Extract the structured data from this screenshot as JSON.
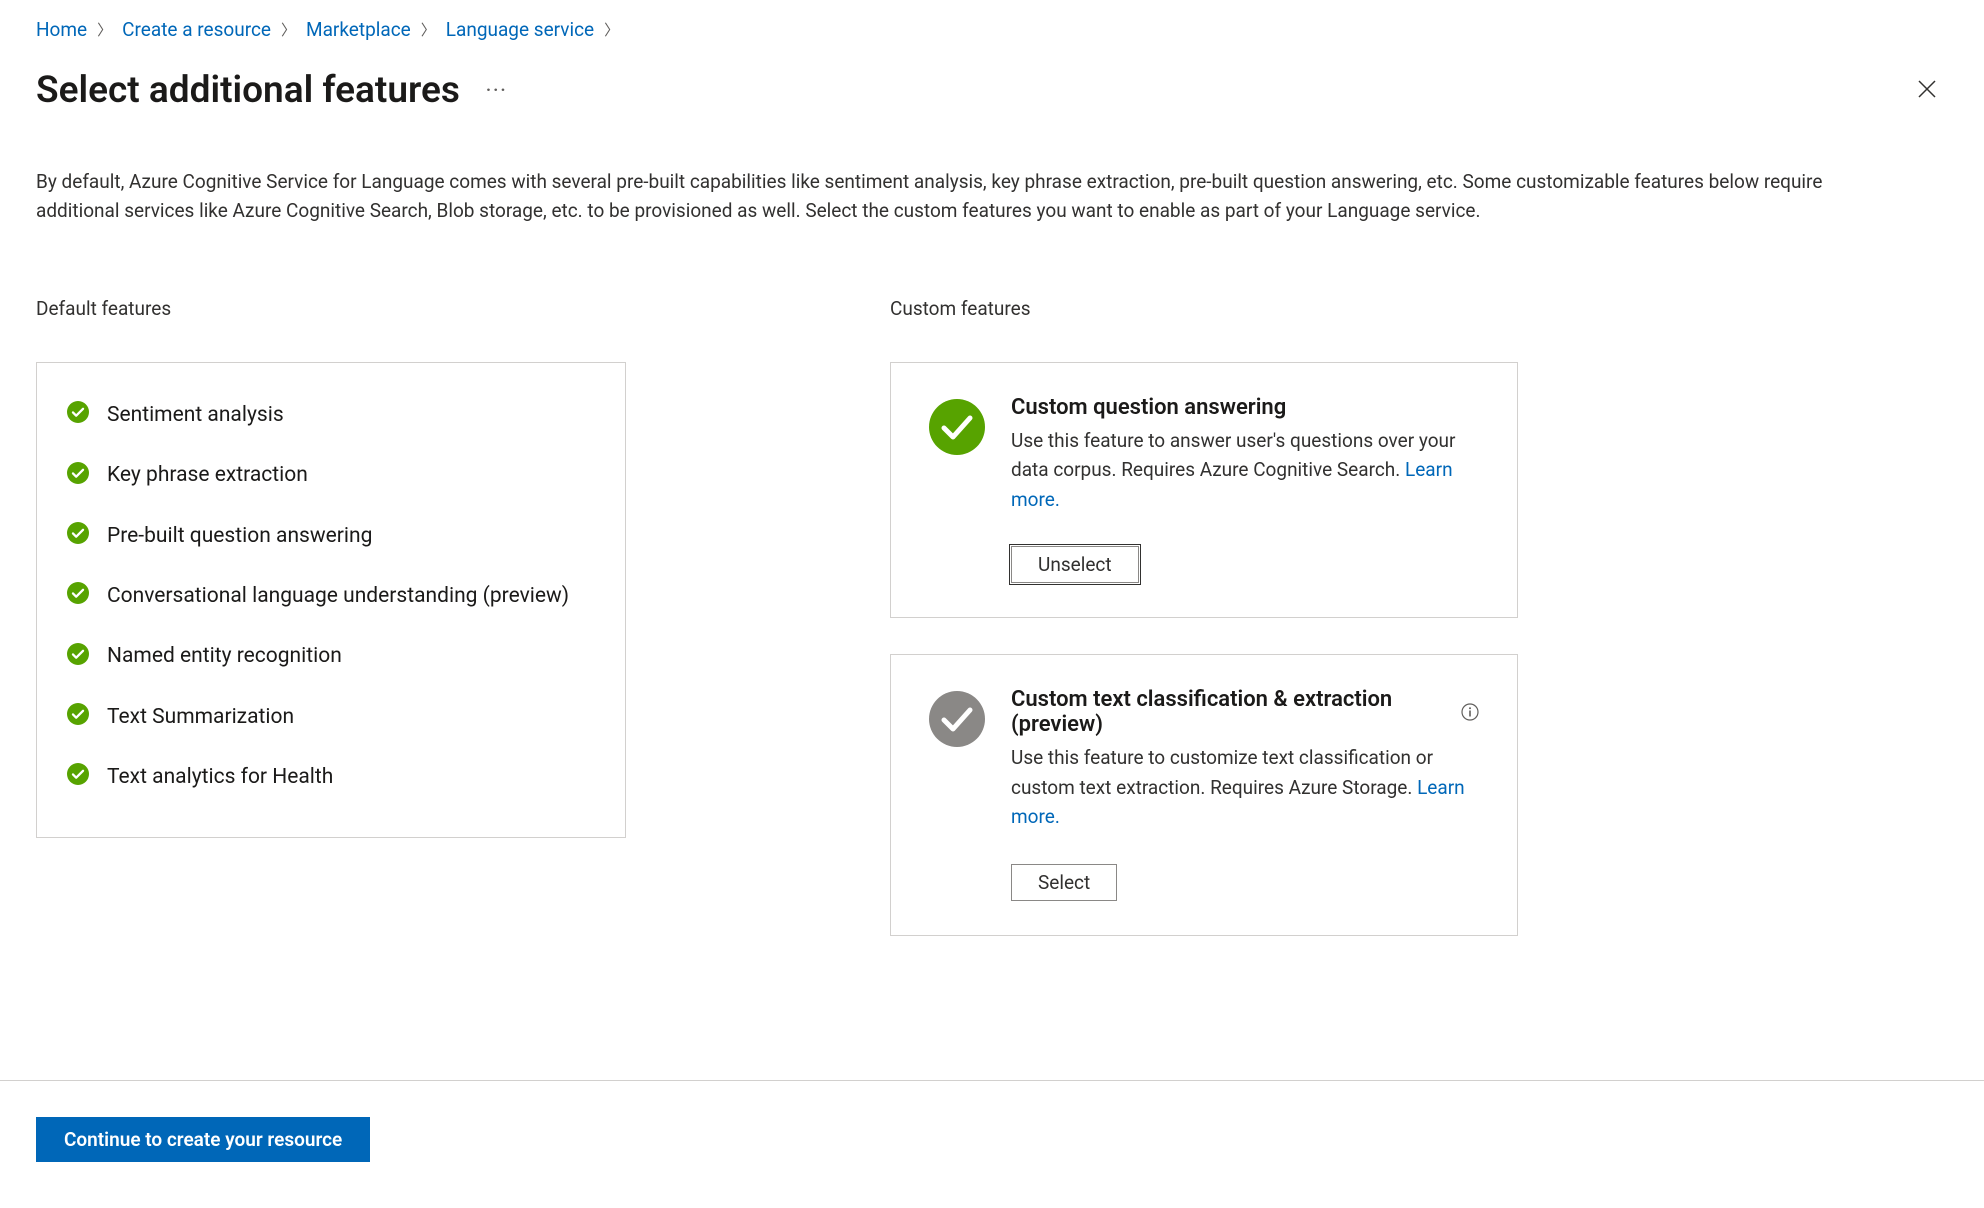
{
  "breadcrumb": {
    "items": [
      {
        "label": "Home"
      },
      {
        "label": "Create a resource"
      },
      {
        "label": "Marketplace"
      },
      {
        "label": "Language service"
      }
    ]
  },
  "page": {
    "title": "Select additional features",
    "intro": "By default, Azure Cognitive Service for Language comes with several pre-built capabilities like sentiment analysis, key phrase extraction, pre-built question answering, etc. Some customizable features below require additional services like Azure Cognitive Search, Blob storage, etc. to be provisioned as well. Select the custom features you want to enable as part of your Language service."
  },
  "sections": {
    "default_label": "Default features",
    "custom_label": "Custom features"
  },
  "default_features": [
    {
      "label": "Sentiment analysis"
    },
    {
      "label": "Key phrase extraction"
    },
    {
      "label": "Pre-built question answering"
    },
    {
      "label": "Conversational language understanding (preview)"
    },
    {
      "label": "Named entity recognition"
    },
    {
      "label": "Text Summarization"
    },
    {
      "label": "Text analytics for Health"
    }
  ],
  "custom_features": [
    {
      "title": "Custom question answering",
      "description": "Use this feature to answer user's questions over your data corpus. Requires Azure Cognitive Search. ",
      "learn_more": "Learn more.",
      "selected": true,
      "button_label": "Unselect",
      "has_info": false
    },
    {
      "title": "Custom text classification & extraction (preview)",
      "description": "Use this feature to customize text classification or custom text extraction. Requires Azure Storage. ",
      "learn_more": "Learn more.",
      "selected": false,
      "button_label": "Select",
      "has_info": true
    }
  ],
  "footer": {
    "continue_label": "Continue to create your resource"
  },
  "colors": {
    "link": "#0067b8",
    "check_green": "#57a300",
    "check_grey": "#8a8886",
    "primary": "#0067b8"
  }
}
